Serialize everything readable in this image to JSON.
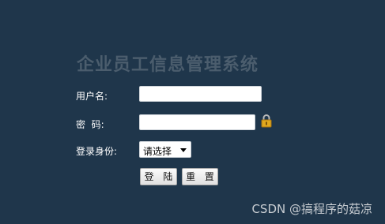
{
  "title": "企业员工信息管理系统",
  "form": {
    "username_label": "用户名:",
    "username_value": "",
    "password_label": "密  码:",
    "password_value": "",
    "role_label": "登录身份:",
    "role_selected": "请选择",
    "login_button": "登 陆",
    "reset_button": "重 置"
  },
  "watermark": "CSDN @搞程序的菇凉",
  "icons": {
    "password_hint": "lock-icon",
    "select_dropdown": "chevron-down-icon"
  },
  "colors": {
    "background": "#1f364b",
    "title": "#4b5d6d",
    "label": "#ffffff",
    "lock": "#e0a81e"
  }
}
